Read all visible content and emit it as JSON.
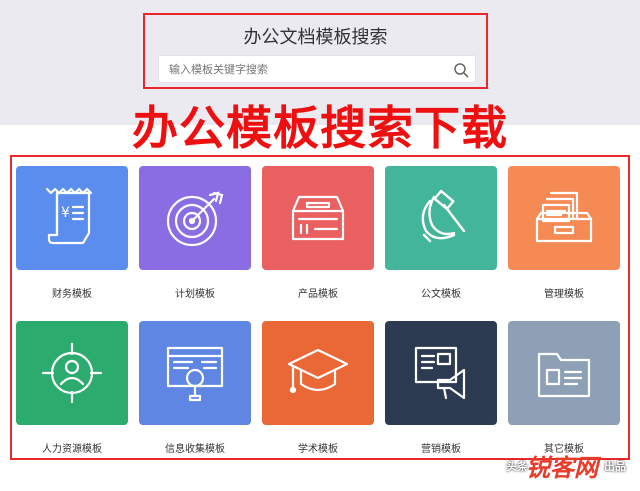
{
  "search": {
    "title": "办公文档模板搜索",
    "placeholder": "输入模板关键字搜索"
  },
  "banner": "办公模板搜索下载",
  "categories": [
    {
      "label": "财务模板",
      "color": "#5b8def",
      "icon": "receipt-icon"
    },
    {
      "label": "计划模板",
      "color": "#8b6de3",
      "icon": "target-icon"
    },
    {
      "label": "产品模板",
      "color": "#ea5f5f",
      "icon": "product-box-icon"
    },
    {
      "label": "公文模板",
      "color": "#42b59b",
      "icon": "hammer-sickle-icon"
    },
    {
      "label": "管理模板",
      "color": "#f58a55",
      "icon": "file-tray-icon"
    },
    {
      "label": "人力资源模板",
      "color": "#2bab6e",
      "icon": "person-target-icon"
    },
    {
      "label": "信息收集模板",
      "color": "#5f86e3",
      "icon": "browser-search-icon"
    },
    {
      "label": "学术模板",
      "color": "#ea6835",
      "icon": "graduation-cap-icon"
    },
    {
      "label": "营销模板",
      "color": "#2d3b52",
      "icon": "megaphone-icon"
    },
    {
      "label": "其它模板",
      "color": "#8ea0b5",
      "icon": "folder-icon"
    }
  ],
  "watermark": {
    "prefix": "头条",
    "mid": "@锐",
    "suffix": "出品",
    "logo": "锐客网"
  }
}
